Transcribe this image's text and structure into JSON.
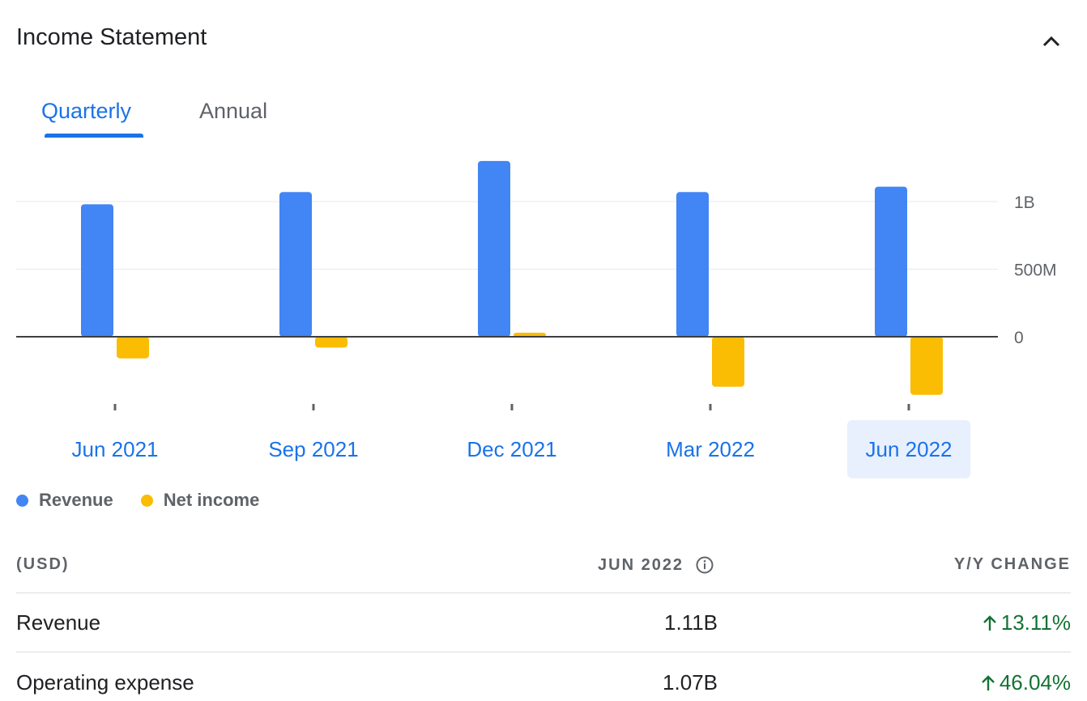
{
  "card": {
    "title": "Income Statement"
  },
  "tabs": [
    {
      "label": "Quarterly",
      "selected": true
    },
    {
      "label": "Annual",
      "selected": false
    }
  ],
  "chart_data": {
    "type": "bar",
    "categories": [
      "Jun 2021",
      "Sep 2021",
      "Dec 2021",
      "Mar 2022",
      "Jun 2022"
    ],
    "series": [
      {
        "name": "Revenue",
        "color": "#4285f4",
        "values": [
          980000000,
          1070000000,
          1300000000,
          1070000000,
          1110000000
        ]
      },
      {
        "name": "Net income",
        "color": "#fbbc04",
        "values": [
          -160000000,
          -80000000,
          30000000,
          -370000000,
          -430000000
        ]
      }
    ],
    "y_ticks": [
      {
        "value": 1000000000,
        "label": "1B"
      },
      {
        "value": 500000000,
        "label": "500M"
      },
      {
        "value": 0,
        "label": "0"
      }
    ],
    "ylim": [
      -500000000,
      1300000000
    ],
    "selected_category": "Jun 2022",
    "legend_position": "bottom-left",
    "grid": true
  },
  "legend": [
    {
      "label": "Revenue",
      "color": "#4285f4"
    },
    {
      "label": "Net income",
      "color": "#fbbc04"
    }
  ],
  "table": {
    "header": {
      "currency": "(USD)",
      "period": "JUN 2022",
      "change": "Y/Y CHANGE"
    },
    "rows": [
      {
        "label": "Revenue",
        "value": "1.11B",
        "change": "13.11%"
      },
      {
        "label": "Operating expense",
        "value": "1.07B",
        "change": "46.04%"
      }
    ]
  },
  "icons": {
    "collapse": "chevron-up-icon",
    "info": "info-icon",
    "change_up": "arrow-up-icon"
  }
}
